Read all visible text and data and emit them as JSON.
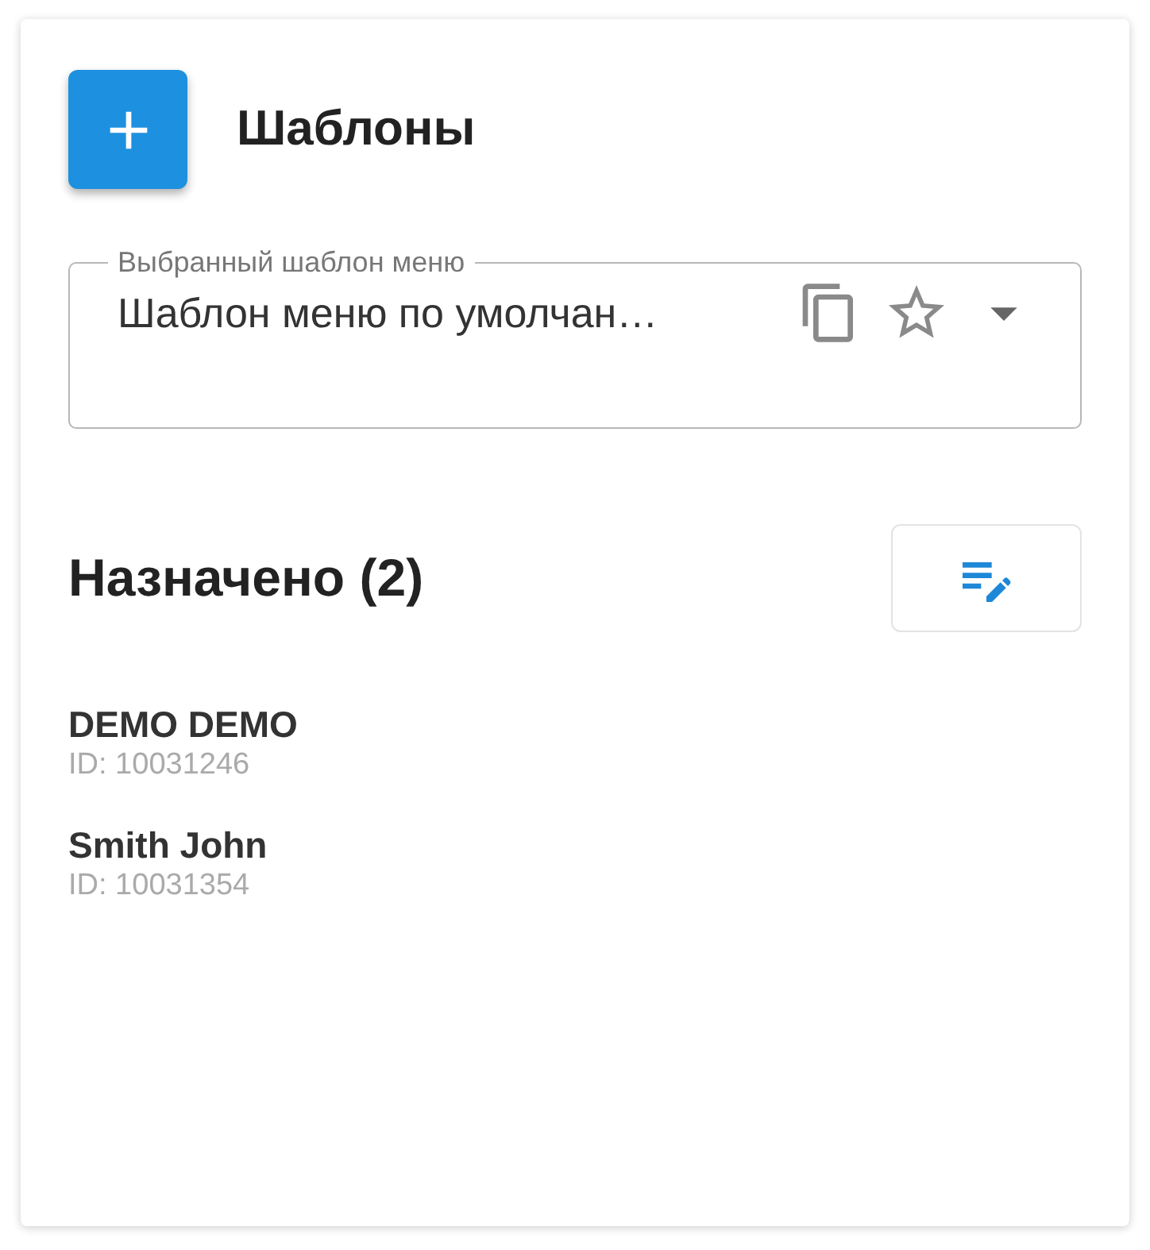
{
  "header": {
    "title": "Шаблоны"
  },
  "template_select": {
    "label": "Выбранный шаблон меню",
    "value": "Шаблон меню по умолчан…"
  },
  "assigned": {
    "title": "Назначено (2)",
    "users": [
      {
        "name": "DEMO DEMO",
        "id": "ID: 10031246"
      },
      {
        "name": "Smith John",
        "id": "ID: 10031354"
      }
    ]
  }
}
